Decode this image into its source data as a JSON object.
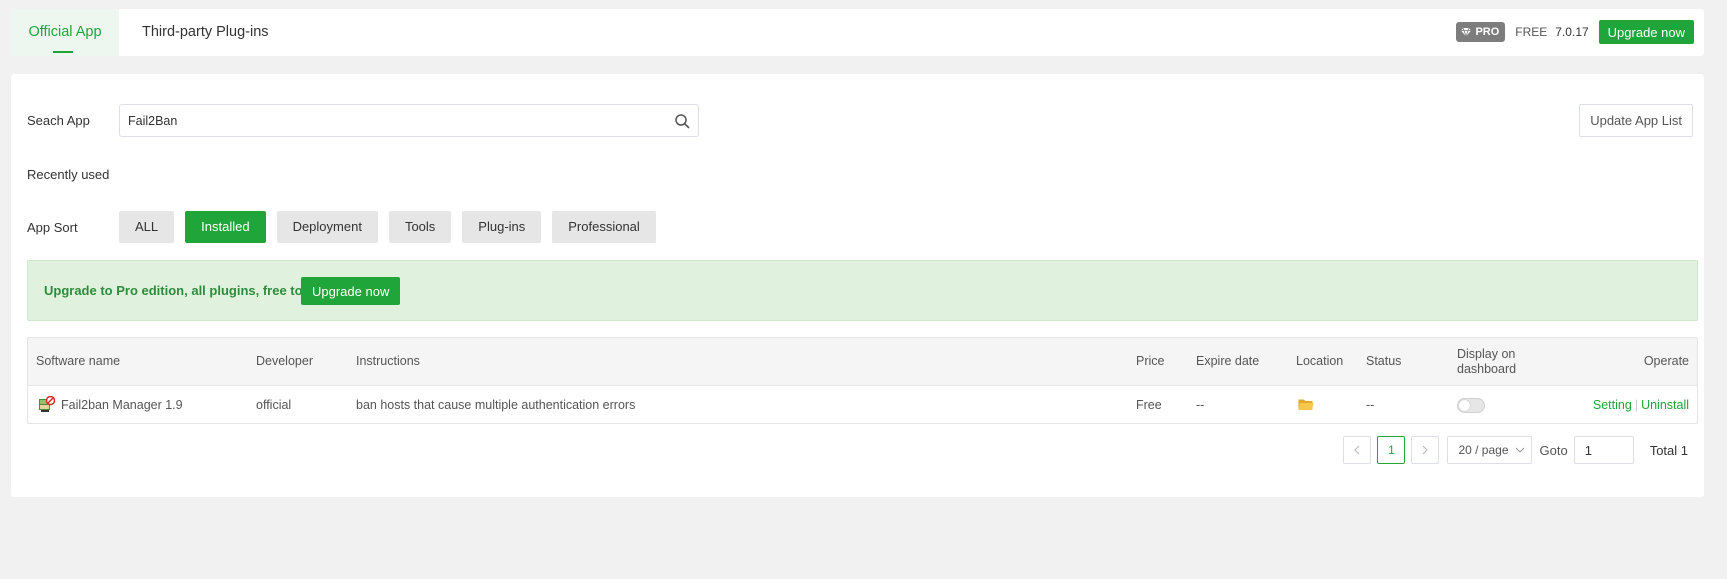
{
  "tabs": [
    {
      "label": "Official App",
      "active": true
    },
    {
      "label": "Third-party Plug-ins",
      "active": false
    }
  ],
  "header": {
    "pro_badge": "PRO",
    "edition": "FREE",
    "version": "7.0.17",
    "upgrade_label": "Upgrade now"
  },
  "search": {
    "label": "Seach App",
    "value": "Fail2Ban",
    "update_label": "Update App List"
  },
  "recent_label": "Recently used",
  "sort": {
    "label": "App Sort",
    "items": [
      "ALL",
      "Installed",
      "Deployment",
      "Tools",
      "Plug-ins",
      "Professional"
    ],
    "active": "Installed"
  },
  "promo": {
    "text": "Upgrade to Pro edition, all plugins, free to use!",
    "button": "Upgrade now"
  },
  "table": {
    "headers": {
      "name": "Software name",
      "developer": "Developer",
      "instructions": "Instructions",
      "price": "Price",
      "expire": "Expire date",
      "location": "Location",
      "status": "Status",
      "display_line1": "Display on",
      "display_line2": "dashboard",
      "operate": "Operate"
    },
    "rows": [
      {
        "name": "Fail2ban Manager 1.9",
        "developer": "official",
        "instructions": "ban hosts that cause multiple authentication errors",
        "price": "Free",
        "expire": "--",
        "status": "--",
        "display_on": false,
        "actions": [
          "Setting",
          "Uninstall"
        ]
      }
    ]
  },
  "pagination": {
    "current": "1",
    "page_size": "20 / page",
    "goto_label": "Goto",
    "goto_value": "1",
    "total": "Total 1"
  },
  "colors": {
    "accent": "#20a53a",
    "promo_bg": "#e0f2de"
  }
}
